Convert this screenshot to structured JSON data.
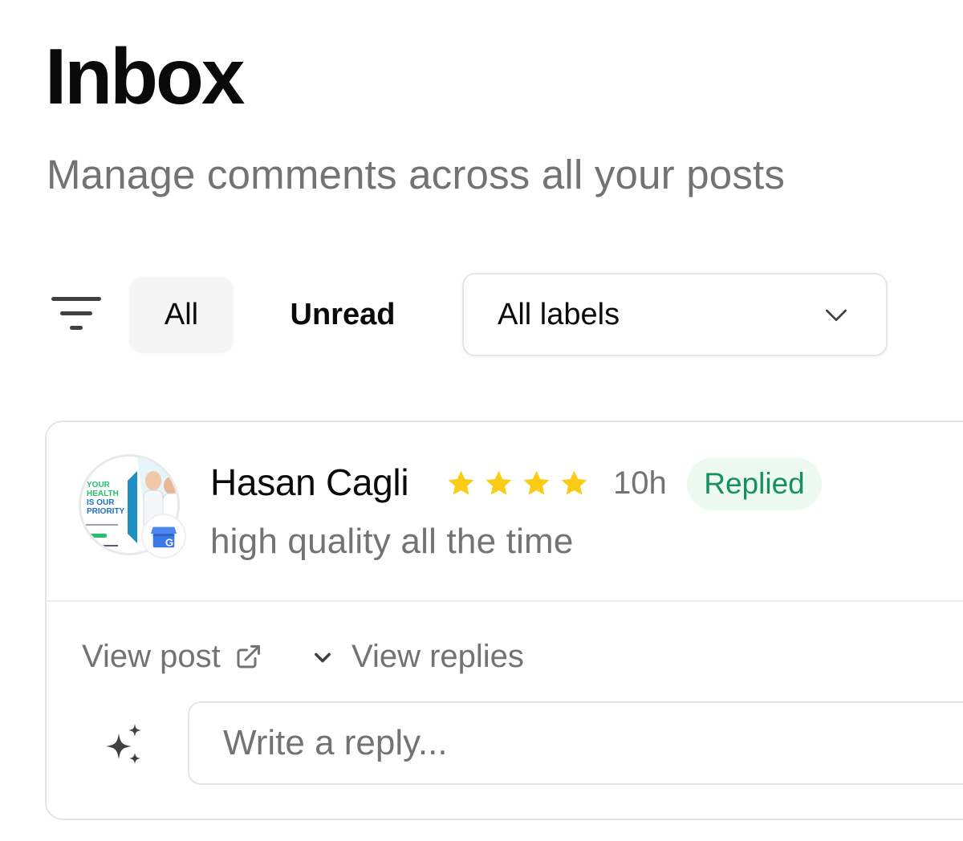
{
  "header": {
    "title": "Inbox",
    "subtitle": "Manage comments across all your posts"
  },
  "filters": {
    "filter_icon": "filter-lines-icon",
    "tabs": [
      {
        "label": "All",
        "active": true
      },
      {
        "label": "Unread",
        "active": false
      }
    ],
    "labels_select": {
      "value": "All labels",
      "icon": "chevron-down-icon"
    }
  },
  "comment": {
    "author": "Hasan Cagli",
    "rating": 4,
    "time": "10h",
    "status": "Replied",
    "text": "high quality all the time",
    "avatar": {
      "lines": [
        "YOUR",
        "HEALTH",
        "IS OUR",
        "PRIORITY"
      ],
      "badge_icon": "google-business-icon"
    },
    "actions": {
      "view_post": "View post",
      "view_replies": "View replies"
    },
    "reply_placeholder": "Write a reply..."
  },
  "colors": {
    "star": "#FACC15",
    "replied_bg": "#ECFAF2",
    "replied_text": "#17905A",
    "muted": "#737373"
  }
}
